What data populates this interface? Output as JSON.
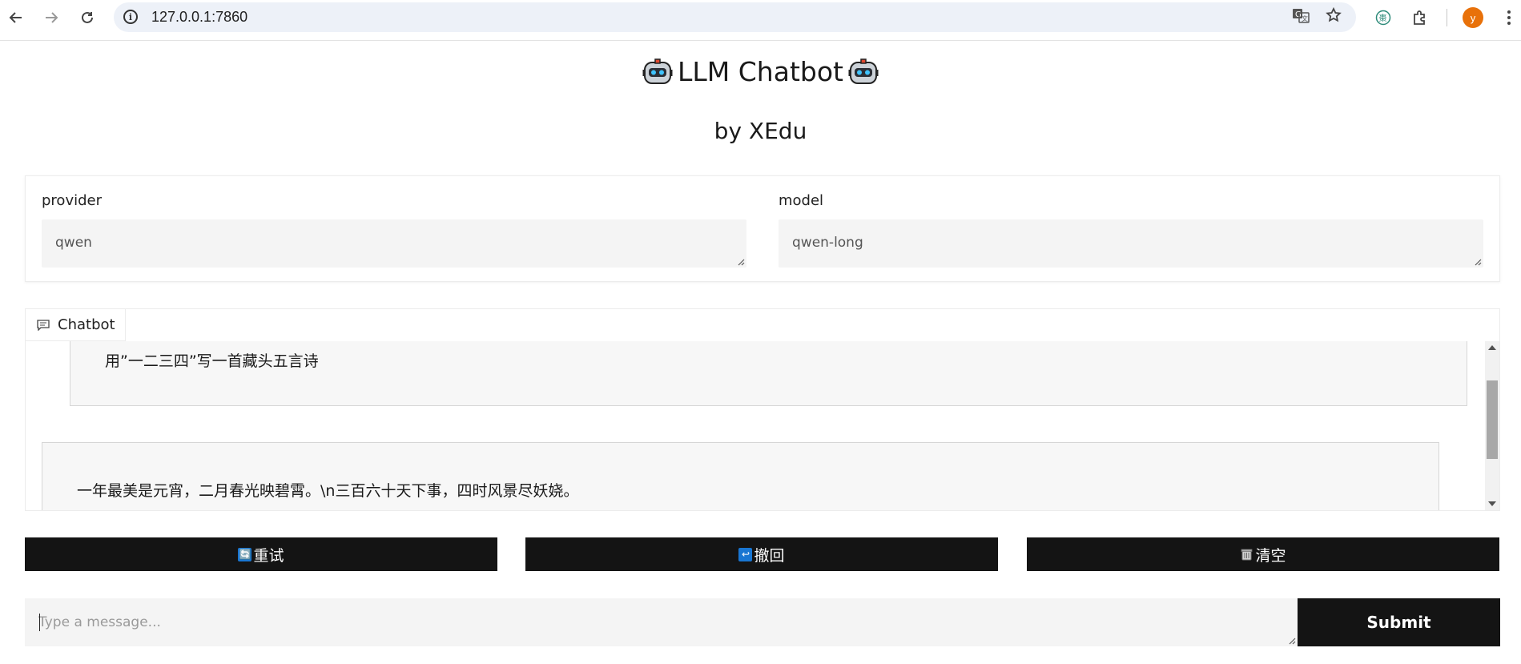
{
  "browser": {
    "url": "127.0.0.1:7860",
    "profile_initial": "y",
    "icons": [
      "back-arrow-icon",
      "forward-arrow-icon",
      "reload-icon",
      "site-info-icon",
      "translate-icon",
      "bookmark-star-icon",
      "extension-logo-icon",
      "extensions-puzzle-icon",
      "kebab-menu-icon"
    ]
  },
  "app": {
    "title": "LLM Chatbot",
    "subtitle": "by XEdu"
  },
  "settings": {
    "provider_label": "provider",
    "provider_value": "qwen",
    "model_label": "model",
    "model_value": "qwen-long"
  },
  "chatbot": {
    "tab_label": "Chatbot",
    "messages": [
      {
        "role": "user",
        "text": "用”一二三四”写一首藏头五言诗"
      },
      {
        "role": "assistant",
        "text": "一年最美是元宵，二月春光映碧霄。\\n三百六十天下事，四时风景尽妖娆。"
      }
    ]
  },
  "buttons": {
    "retry_label": "重试",
    "retry_icon": "🔄",
    "undo_label": "撤回",
    "undo_icon": "↩",
    "clear_label": "清空",
    "clear_icon": "trash-icon"
  },
  "input": {
    "placeholder": "Type a message...",
    "submit_label": "Submit"
  },
  "colors": {
    "button_bg": "#141414",
    "input_bg": "#f4f4f4",
    "avatar": "#e8710a"
  }
}
